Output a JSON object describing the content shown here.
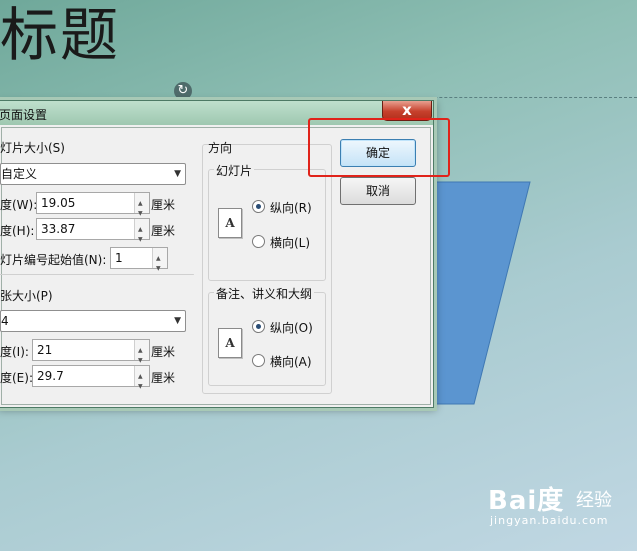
{
  "slide": {
    "title": "标题"
  },
  "dialog": {
    "title": "页面设置",
    "close_symbol": "x",
    "slide_size": {
      "group_label": "灯片大小(S)",
      "preset": "自定义",
      "width_label": "度(W):",
      "width_value": "19.05",
      "height_label": "度(H):",
      "height_value": "33.87",
      "unit": "厘米",
      "numbering_label": "灯片编号起始值(N):",
      "numbering_value": "1"
    },
    "paper_size": {
      "group_label": "张大小(P)",
      "preset": "4",
      "width_label": "度(I):",
      "width_value": "21",
      "height_label": "度(E):",
      "height_value": "29.7",
      "unit": "厘米"
    },
    "orientation": {
      "group_label": "方向",
      "slides": {
        "label": "幻灯片",
        "portrait": "纵向(R)",
        "landscape": "横向(L)",
        "selected": "portrait"
      },
      "notes": {
        "label": "备注、讲义和大纲",
        "portrait": "纵向(O)",
        "landscape": "横向(A)",
        "selected": "portrait"
      },
      "page_icon_letter": "A"
    },
    "ok_label": "确定",
    "cancel_label": "取消"
  },
  "watermark": {
    "logo": "Bai度",
    "cn": "经验",
    "url": "jingyan.baidu.com"
  },
  "colors": {
    "shape_fill": "#5b95d0",
    "highlight": "#e0231a",
    "title_bar": "#a8ccb8"
  },
  "icons": {
    "rotate": "rotate-icon",
    "close": "close-icon",
    "spin": "spin-arrows-icon",
    "dropdown": "chevron-down-icon"
  }
}
